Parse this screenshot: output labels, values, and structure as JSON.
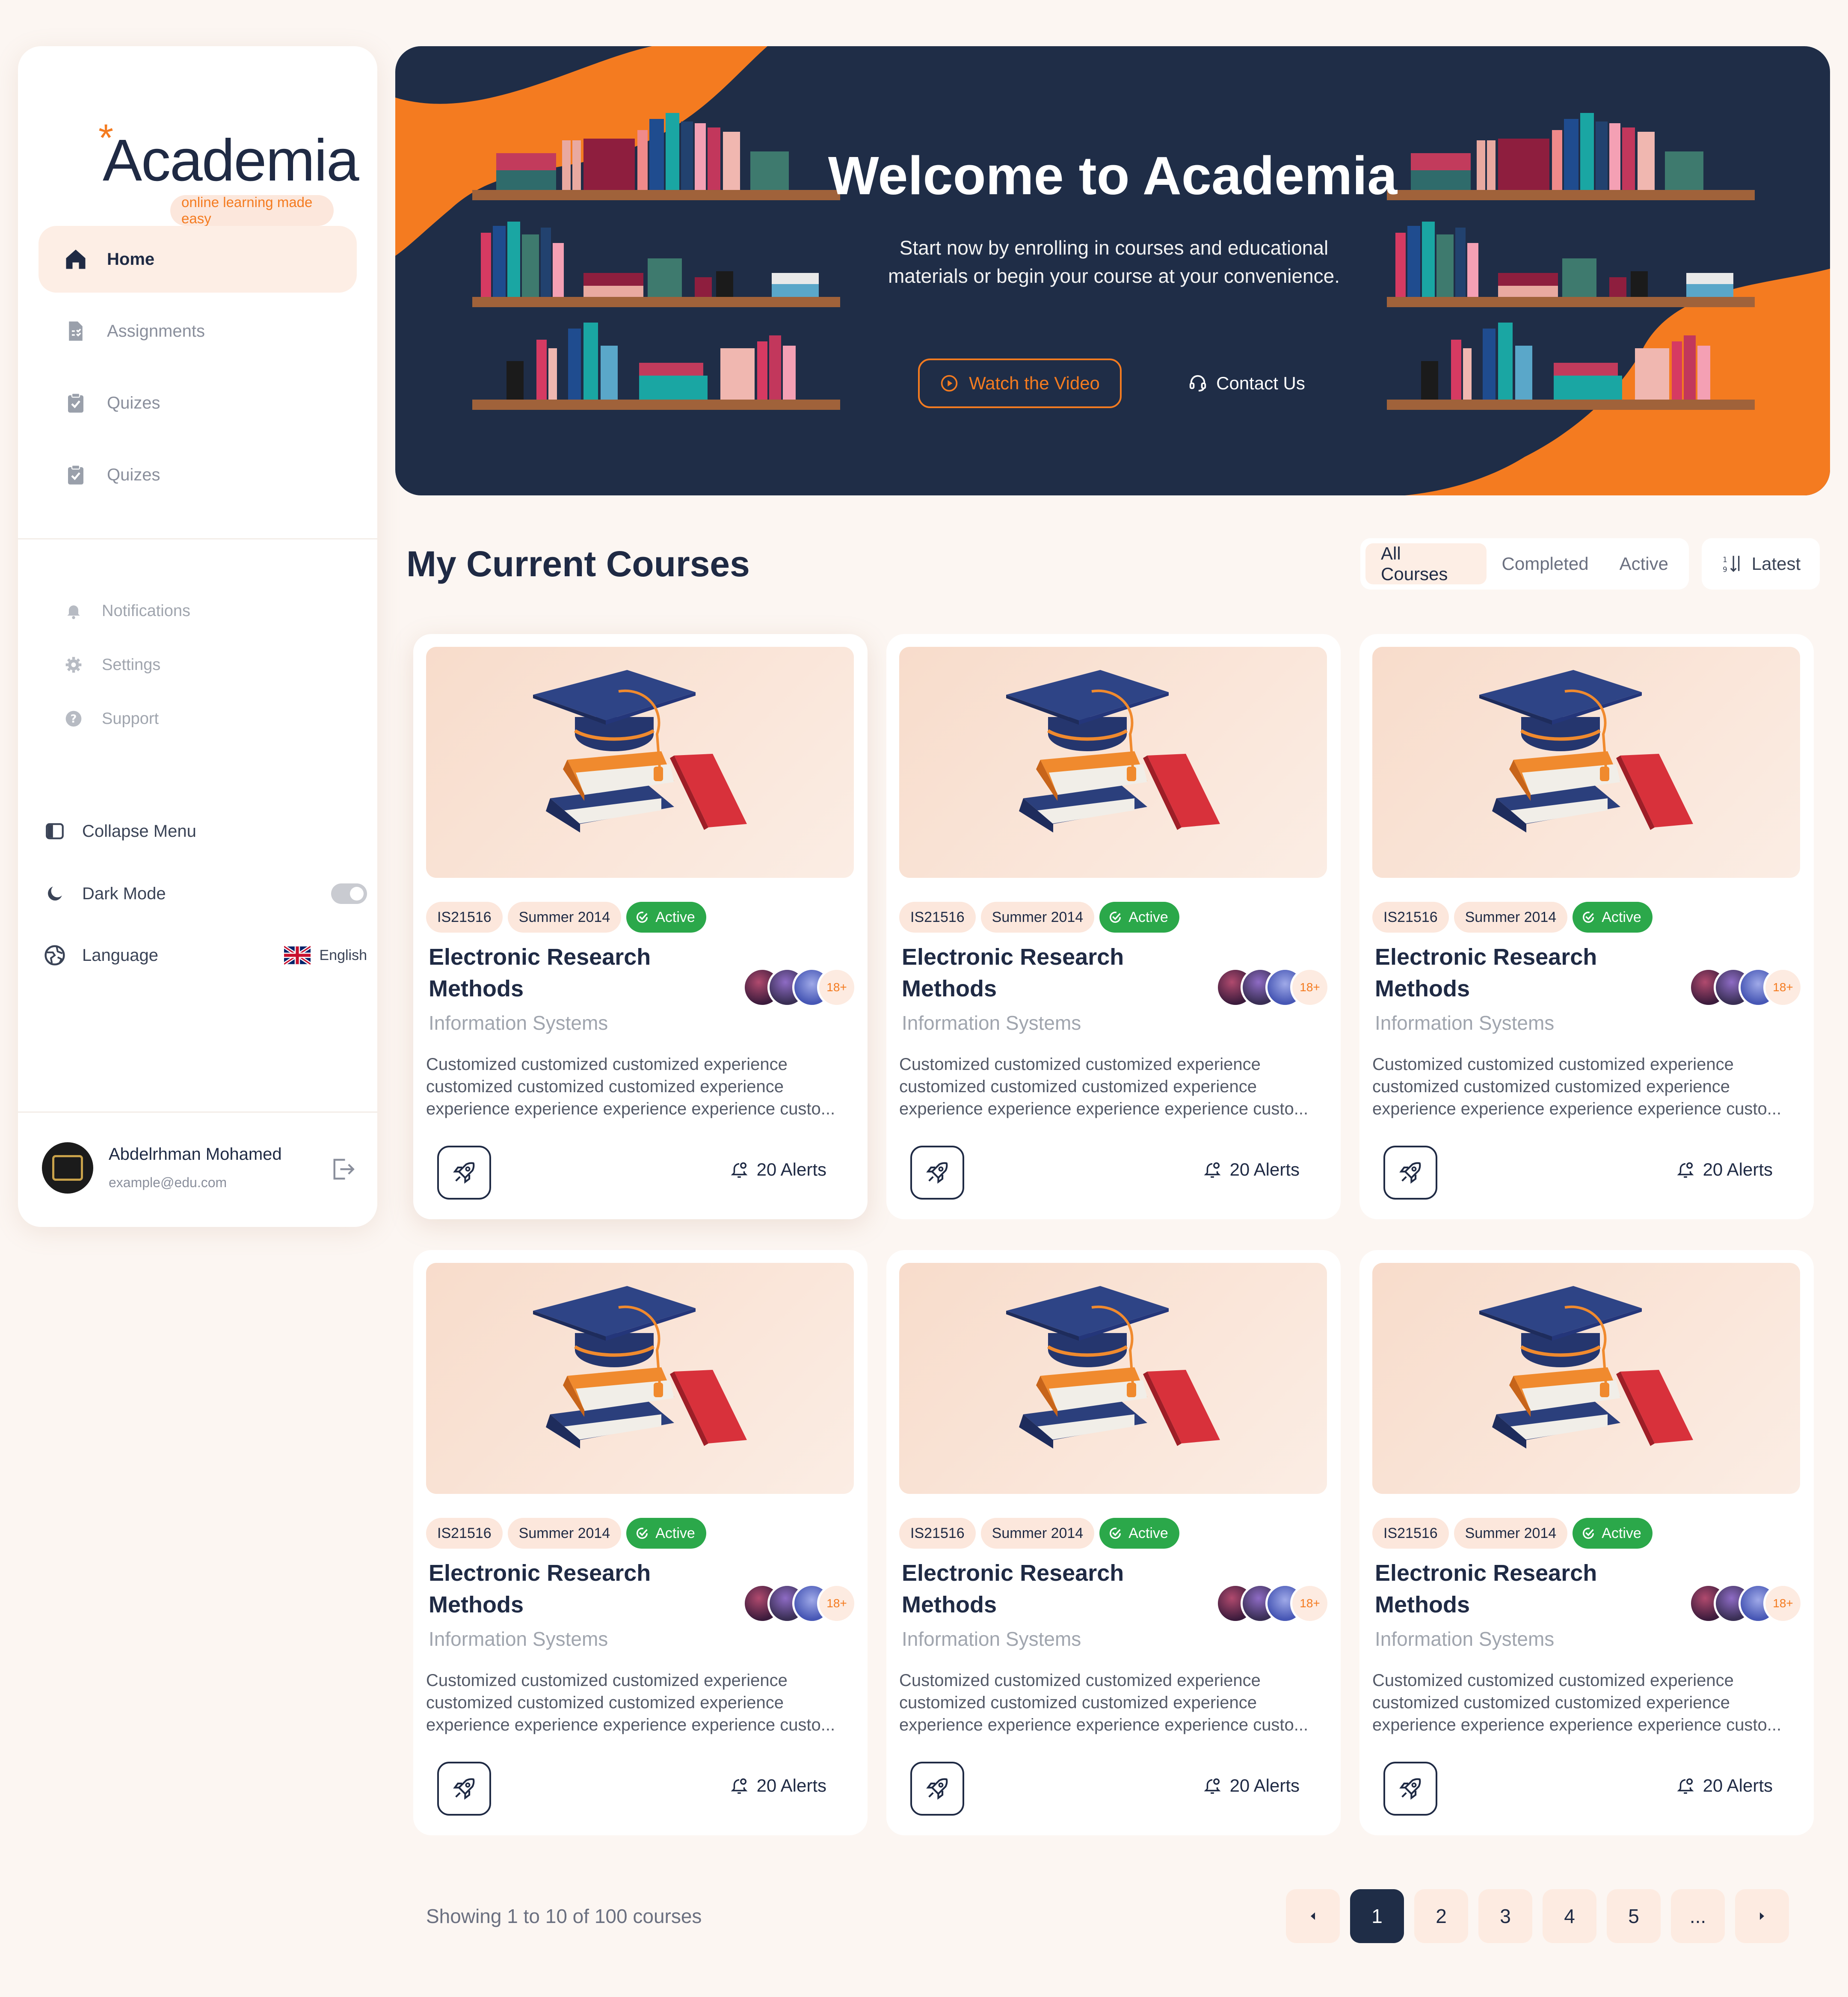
{
  "brand": {
    "name": "Academia",
    "tagline": "online learning made easy",
    "accent": "#F47B20",
    "navy": "#1F2D47"
  },
  "sidebar": {
    "nav": [
      {
        "label": "Home",
        "icon": "home-icon",
        "active": true
      },
      {
        "label": "Assignments",
        "icon": "assignment-icon"
      },
      {
        "label": "Quizes",
        "icon": "clipboard-check-icon"
      },
      {
        "label": "Quizes",
        "icon": "clipboard-check-icon"
      }
    ],
    "secondary": [
      {
        "label": "Notifications",
        "icon": "bell-icon"
      },
      {
        "label": "Settings",
        "icon": "gear-icon"
      },
      {
        "label": "Support",
        "icon": "help-icon"
      }
    ],
    "collapse_label": "Collapse Menu",
    "dark_mode_label": "Dark Mode",
    "language_label": "Language",
    "language_value": "English",
    "user": {
      "name": "Abdelrhman Mohamed",
      "email": "example@edu.com"
    }
  },
  "hero": {
    "title": "Welcome to Academia",
    "subtitle": "Start now by enrolling in courses and educational materials or begin your course at your convenience.",
    "watch_label": "Watch the Video",
    "contact_label": "Contact Us"
  },
  "courses": {
    "title": "My Current Courses",
    "filters": [
      "All Courses",
      "Completed",
      "Active"
    ],
    "active_filter": "All Courses",
    "sort_label": "Latest",
    "items": [
      {
        "code": "IS21516",
        "term": "Summer 2014",
        "status": "Active",
        "title": "Electronic Research Methods",
        "subject": "Information Systems",
        "more_count": "18+",
        "desc": [
          "Customized customized customized experience",
          "customized customized customized experience",
          "experience experience experience experience custo..."
        ],
        "alerts": "20 Alerts"
      },
      {
        "code": "IS21516",
        "term": "Summer 2014",
        "status": "Active",
        "title": "Electronic Research Methods",
        "subject": "Information Systems",
        "more_count": "18+",
        "desc": [
          "Customized customized customized experience",
          "customized customized customized experience",
          "experience experience experience experience custo..."
        ],
        "alerts": "20 Alerts"
      },
      {
        "code": "IS21516",
        "term": "Summer 2014",
        "status": "Active",
        "title": "Electronic Research Methods",
        "subject": "Information Systems",
        "more_count": "18+",
        "desc": [
          "Customized customized customized experience",
          "customized customized customized experience",
          "experience experience experience experience custo..."
        ],
        "alerts": "20 Alerts"
      },
      {
        "code": "IS21516",
        "term": "Summer 2014",
        "status": "Active",
        "title": "Electronic Research Methods",
        "subject": "Information Systems",
        "more_count": "18+",
        "desc": [
          "Customized customized customized experience",
          "customized customized customized experience",
          "experience experience experience experience custo..."
        ],
        "alerts": "20 Alerts"
      },
      {
        "code": "IS21516",
        "term": "Summer 2014",
        "status": "Active",
        "title": "Electronic Research Methods",
        "subject": "Information Systems",
        "more_count": "18+",
        "desc": [
          "Customized customized customized experience",
          "customized customized customized experience",
          "experience experience experience experience custo..."
        ],
        "alerts": "20 Alerts"
      },
      {
        "code": "IS21516",
        "term": "Summer 2014",
        "status": "Active",
        "title": "Electronic Research Methods",
        "subject": "Information Systems",
        "more_count": "18+",
        "desc": [
          "Customized customized customized experience",
          "customized customized customized experience",
          "experience experience experience experience custo..."
        ],
        "alerts": "20 Alerts"
      }
    ]
  },
  "pagination": {
    "summary": "Showing 1 to 10 of 100 courses",
    "pages": [
      "1",
      "2",
      "3",
      "4",
      "5",
      "..."
    ],
    "current": "1"
  }
}
